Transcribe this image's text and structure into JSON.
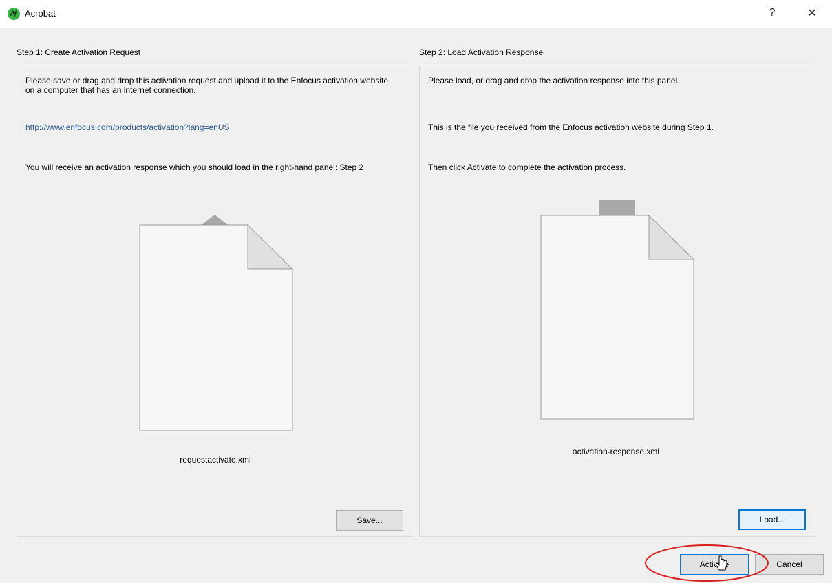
{
  "window": {
    "title": "Acrobat",
    "help_glyph": "?",
    "close_glyph": "✕"
  },
  "step1": {
    "heading": "Step 1: Create Activation Request",
    "paragraph1": "Please save or drag and drop this activation request and upload it to the Enfocus activation website on a computer that has an internet connection.",
    "link": "http://www.enfocus.com/products/activation?lang=enUS",
    "paragraph2": "You will receive an activation response which you should load in the right-hand panel: Step 2",
    "filename": "requestactivate.xml",
    "save_label": "Save..."
  },
  "step2": {
    "heading": "Step 2: Load Activation Response",
    "paragraph1": "Please load, or drag and drop the activation response into this panel.",
    "paragraph2": "This is the file you received from the Enfocus activation website during Step 1.",
    "paragraph3": "Then click Activate to complete the activation process.",
    "filename": "activation-response.xml",
    "load_label": "Load..."
  },
  "footer": {
    "activate_label": "Activate",
    "cancel_label": "Cancel"
  },
  "icons": {
    "app": "acrobat-app-icon",
    "upload_doc": "upload-document-icon",
    "download_doc": "download-document-icon",
    "cursor": "mouse-pointer-icon"
  },
  "colors": {
    "link": "#2a5a93",
    "highlight": "#d62020",
    "focus_border": "#0078d7",
    "app_icon_bg": "#3cb44a"
  }
}
